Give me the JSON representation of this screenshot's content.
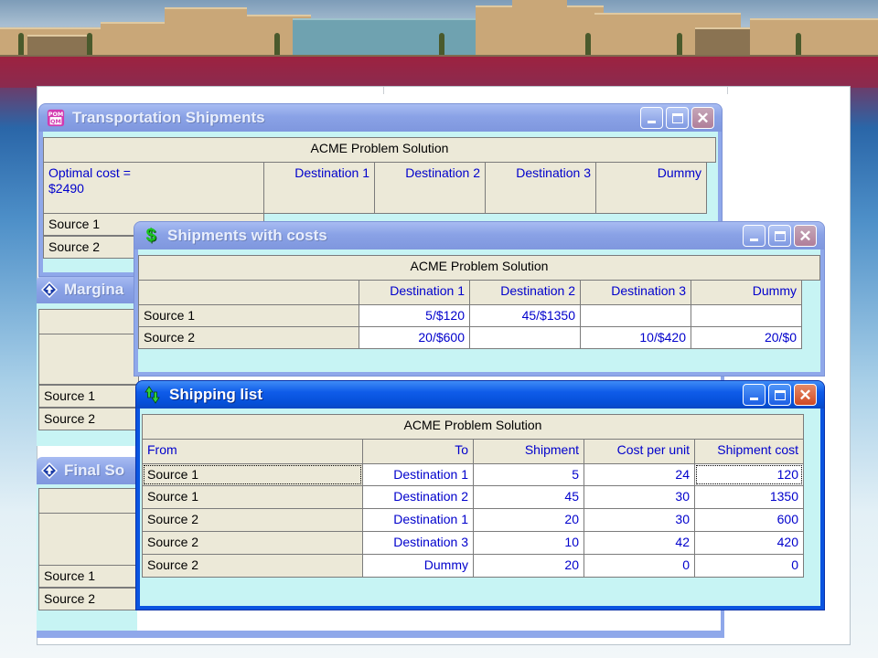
{
  "header": "ACME Problem Solution",
  "win_transport": {
    "title": "Transportation Shipments",
    "optimal_cost": "Optimal cost =",
    "optimal_value": "$2490",
    "columns": [
      "Destination 1",
      "Destination 2",
      "Destination 3",
      "Dummy"
    ],
    "rows": [
      "Source 1",
      "Source 2"
    ]
  },
  "win_marginal": {
    "title": "Margina",
    "rows": [
      "Source 1",
      "Source 2"
    ]
  },
  "win_final": {
    "title": "Final So",
    "rows": [
      "Source 1",
      "Source 2"
    ]
  },
  "win_costs": {
    "title": "Shipments with costs",
    "columns": [
      "Destination 1",
      "Destination 2",
      "Destination 3",
      "Dummy"
    ],
    "rows": [
      {
        "label": "Source 1",
        "cells": [
          "5/$120",
          "45/$1350",
          "",
          ""
        ]
      },
      {
        "label": "Source 2",
        "cells": [
          "20/$600",
          "",
          "10/$420",
          "20/$0"
        ]
      }
    ]
  },
  "win_shipping": {
    "title": "Shipping list",
    "columns": [
      "From",
      "To",
      "Shipment",
      "Cost per unit",
      "Shipment cost"
    ],
    "rows": [
      {
        "from": "Source 1",
        "to": "Destination 1",
        "shipment": "5",
        "cost": "24",
        "total": "120"
      },
      {
        "from": "Source 1",
        "to": "Destination 2",
        "shipment": "45",
        "cost": "30",
        "total": "1350"
      },
      {
        "from": "Source 2",
        "to": "Destination 1",
        "shipment": "20",
        "cost": "30",
        "total": "600"
      },
      {
        "from": "Source 2",
        "to": "Destination 3",
        "shipment": "10",
        "cost": "42",
        "total": "420"
      },
      {
        "from": "Source 2",
        "to": "Dummy",
        "shipment": "20",
        "cost": "0",
        "total": "0"
      }
    ]
  },
  "icons": {
    "transport": "pom-qm-logo-icon",
    "costs": "dollar-icon",
    "shipping": "up-down-arrow-icon",
    "marginal": "diamond-arrow-icon",
    "final": "diamond-arrow-icon"
  },
  "colors": {
    "active_title": "#0a54e0",
    "inactive_title": "#8aa2e6",
    "grid_bg": "#c7f4f4",
    "value_text": "#0000cc"
  }
}
